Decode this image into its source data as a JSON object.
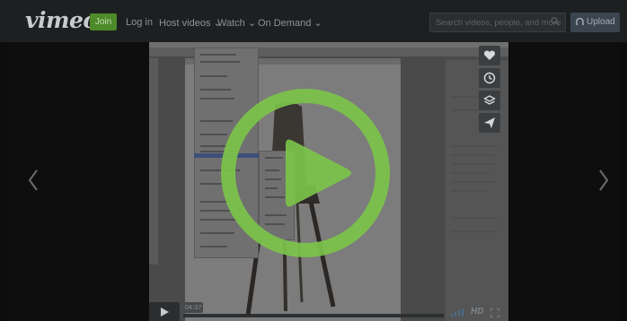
{
  "header": {
    "logo_text": "vimeo",
    "join_label": "Join",
    "login_label": "Log in",
    "host_label": "Host videos ⌄",
    "watch_label": "Watch ⌄",
    "ondemand_label": "On Demand ⌄",
    "search_placeholder": "Search videos, people, and more",
    "upload_label": "Upload"
  },
  "player": {
    "timecode": "04:37",
    "hd_label": "HD",
    "progress_fraction": 0.0
  },
  "colors": {
    "play_accent": "#7cc34a",
    "join_green": "#4d8a29"
  },
  "icons": {
    "search": "search-icon",
    "upload": "upload-icon",
    "like": "heart-icon",
    "later": "clock-icon",
    "collections": "layers-icon",
    "share": "paper-plane-icon",
    "play": "play-icon",
    "volume": "volume-icon",
    "fullscreen": "fullscreen-icon",
    "prev": "chevron-left-icon",
    "next": "chevron-right-icon"
  }
}
